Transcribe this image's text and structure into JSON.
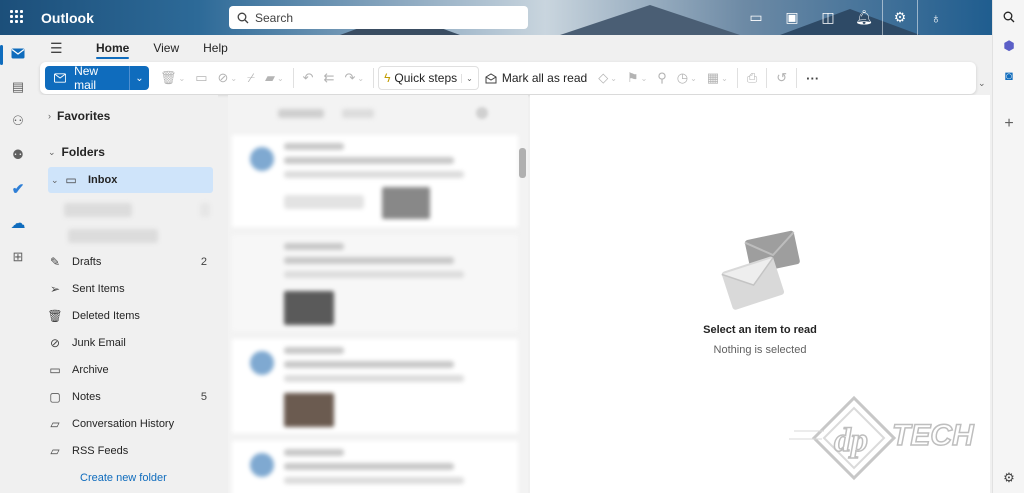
{
  "app": {
    "brand": "Outlook"
  },
  "search": {
    "placeholder": "Search"
  },
  "ribbon": {
    "tabs": [
      {
        "label": "Home"
      },
      {
        "label": "View"
      },
      {
        "label": "Help"
      }
    ],
    "new_mail": "New mail",
    "quick_steps": "Quick steps",
    "mark_all_read": "Mark all as read"
  },
  "folders": {
    "favorites": "Favorites",
    "folders_header": "Folders",
    "items": [
      {
        "label": "Inbox",
        "count": ""
      },
      {
        "label": "Drafts",
        "count": "2"
      },
      {
        "label": "Sent Items",
        "count": ""
      },
      {
        "label": "Deleted Items",
        "count": ""
      },
      {
        "label": "Junk Email",
        "count": ""
      },
      {
        "label": "Archive",
        "count": ""
      },
      {
        "label": "Notes",
        "count": "5"
      },
      {
        "label": "Conversation History",
        "count": ""
      },
      {
        "label": "RSS Feeds",
        "count": ""
      }
    ],
    "create_new": "Create new folder"
  },
  "reading_pane": {
    "title": "Select an item to read",
    "subtitle": "Nothing is selected"
  },
  "colors": {
    "accent": "#0f6cbd",
    "selected_folder": "#cfe4fa"
  }
}
